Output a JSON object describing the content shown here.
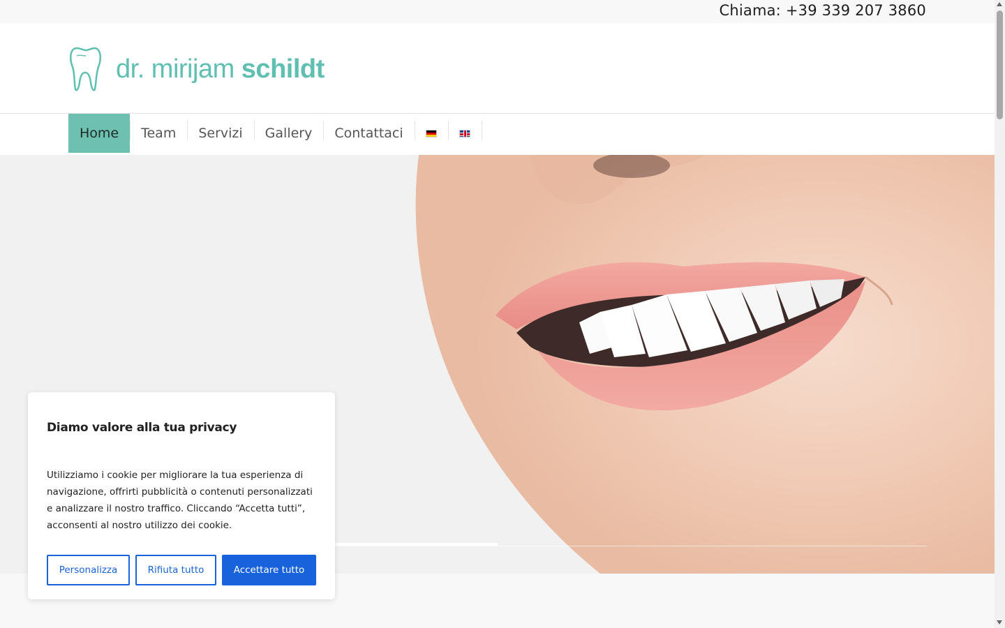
{
  "topbar": {
    "phone_text": "Chiama: +39 339 207 3860"
  },
  "header": {
    "logo_prefix": "dr. mirijam ",
    "logo_bold": "schildt"
  },
  "nav": {
    "items": [
      {
        "label": "Home",
        "active": true
      },
      {
        "label": "Team"
      },
      {
        "label": "Servizi"
      },
      {
        "label": "Gallery"
      },
      {
        "label": "Contattaci"
      }
    ],
    "languages": [
      "german-flag-icon",
      "english-flag-icon"
    ]
  },
  "slider": {
    "progress": 0.5
  },
  "cookie": {
    "title": "Diamo valore alla tua privacy",
    "text": "Utilizziamo i cookie per migliorare la tua esperienza di navigazione, offrirti pubblicità o contenuti personalizzati e analizzare il nostro traffico. Cliccando “Accetta tutti”, acconsenti al nostro utilizzo dei cookie.",
    "customize_label": "Personalizza",
    "reject_label": "Rifiuta tutto",
    "accept_label": "Accettare tutto"
  },
  "colors": {
    "brand": "#5fbfb1",
    "nav_active": "#6ec0b0",
    "cookie_accent": "#1863dc"
  }
}
